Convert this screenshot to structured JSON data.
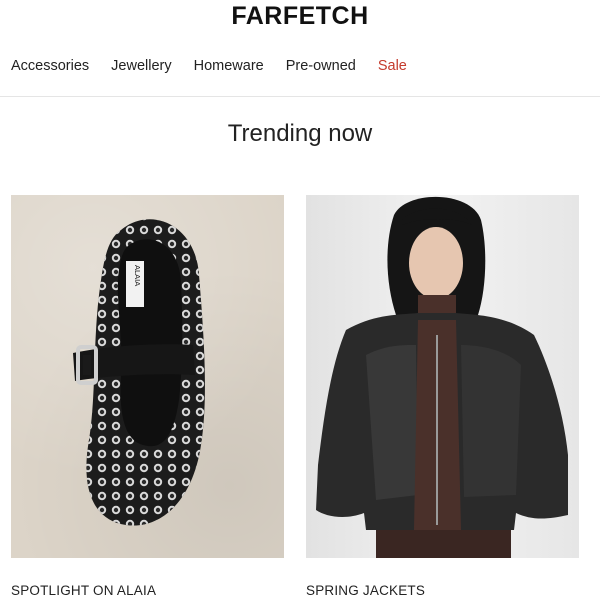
{
  "brand": {
    "logo_text": "FARFETCH"
  },
  "nav": {
    "items": [
      {
        "label": "Accessories"
      },
      {
        "label": "Jewellery"
      },
      {
        "label": "Homeware"
      },
      {
        "label": "Pre-owned"
      },
      {
        "label": "Sale"
      }
    ],
    "sale_color": "#c43a2c"
  },
  "section": {
    "title": "Trending now"
  },
  "cards": [
    {
      "caption": "SPOTLIGHT ON ALAIA",
      "image_label": "ALAIA"
    },
    {
      "caption": "SPRING JACKETS"
    }
  ]
}
